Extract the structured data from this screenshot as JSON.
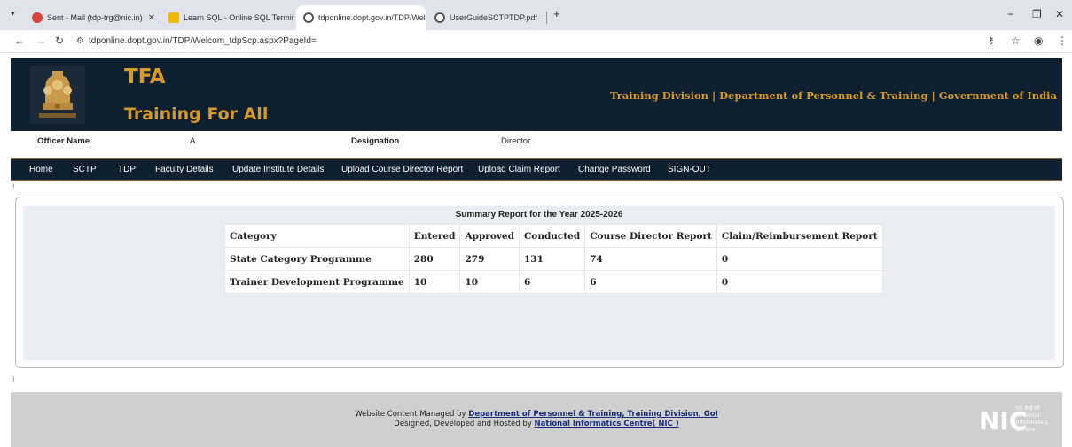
{
  "browser": {
    "tabs": [
      {
        "title": "Sent - Mail (tdp-trg@nic.in)",
        "active": false
      },
      {
        "title": "Learn SQL - Online SQL Termin",
        "active": false
      },
      {
        "title": "tdponline.dopt.gov.in/TDP/Wel",
        "active": true
      },
      {
        "title": "UserGuideSCTPTDP.pdf",
        "active": false
      }
    ],
    "url": "tdponline.dopt.gov.in/TDP/Welcom_tdpScp.aspx?PageId="
  },
  "header": {
    "title": "TFA",
    "subtitle": "Training For All",
    "department": "Training Division | Department of Personnel & Training | Government of India"
  },
  "officer": {
    "name_label": "Officer Name",
    "name_value": "A",
    "designation_label": "Designation",
    "designation_value": "Director"
  },
  "menu": {
    "items": [
      "Home",
      "SCTP",
      "TDP",
      "Faculty Details",
      "Update Institute Details",
      "Upload Course Director Report",
      "Upload Claim Report",
      "Change Password",
      "SIGN-OUT"
    ]
  },
  "report": {
    "title": "Summary Report for the Year 2025-2026",
    "columns": [
      "Category",
      "Entered",
      "Approved",
      "Conducted",
      "Course Director Report",
      "Claim/Reimbursement Report"
    ],
    "rows": [
      [
        "State Category Programme",
        "280",
        "279",
        "131",
        "74",
        "0"
      ],
      [
        "Trainer Development Programme",
        "10",
        "10",
        "6",
        "6",
        "0"
      ]
    ]
  },
  "footer": {
    "line1_prefix": "Website Content Managed by ",
    "line1_link": "Department of Personnel & Training, Training Division, GoI",
    "line2_prefix": "Designed, Developed and Hosted by ",
    "line2_link": "National Informatics Centre( NIC )",
    "nic_logo_text": "NIC",
    "nic_caption": [
      "एन आई सी",
      "National",
      "Informatics",
      "Centre"
    ]
  },
  "markers": [
    "!",
    "!"
  ],
  "colors": {
    "banner_bg": "#0e2030",
    "accent_gold": "#d79a2a",
    "panel_bg": "#e8eef3",
    "footer_bg": "#cfcfcf",
    "link": "#1a2d7a"
  }
}
